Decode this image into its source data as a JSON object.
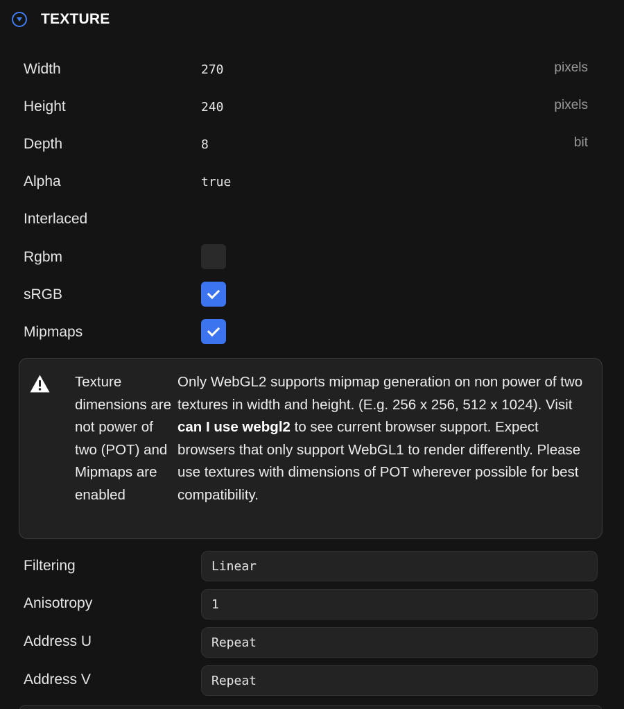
{
  "section": {
    "title": "TEXTURE",
    "collapse_icon": "chevron-down-circle-icon",
    "accent_color": "#3f7cf0"
  },
  "properties": [
    {
      "label": "Width",
      "value": "270",
      "unit": "pixels"
    },
    {
      "label": "Height",
      "value": "240",
      "unit": "pixels"
    },
    {
      "label": "Depth",
      "value": "8",
      "unit": "bit"
    },
    {
      "label": "Alpha",
      "value": "true"
    },
    {
      "label": "Interlaced",
      "value": ""
    }
  ],
  "checkboxes": [
    {
      "label": "Rgbm",
      "checked": false
    },
    {
      "label": "sRGB",
      "checked": true
    },
    {
      "label": "Mipmaps",
      "checked": true
    }
  ],
  "warning": {
    "icon": "warning-triangle-icon",
    "title": "Texture dimensions are not power of two (POT) and Mipmaps are enabled",
    "text_before": "Only WebGL2 supports mipmap generation on non power of two textures in width and height. (E.g. 256 x 256, 512 x 1024). Visit ",
    "link": "can I use webgl2",
    "text_after": " to see current browser support. Expect browsers that only support WebGL1 to render differently. Please use textures with dimensions of POT wherever possible for best compatibility."
  },
  "selects": [
    {
      "label": "Filtering",
      "value": "Linear"
    },
    {
      "label": "Anisotropy",
      "value": "1"
    },
    {
      "label": "Address U",
      "value": "Repeat"
    },
    {
      "label": "Address V",
      "value": "Repeat"
    }
  ]
}
